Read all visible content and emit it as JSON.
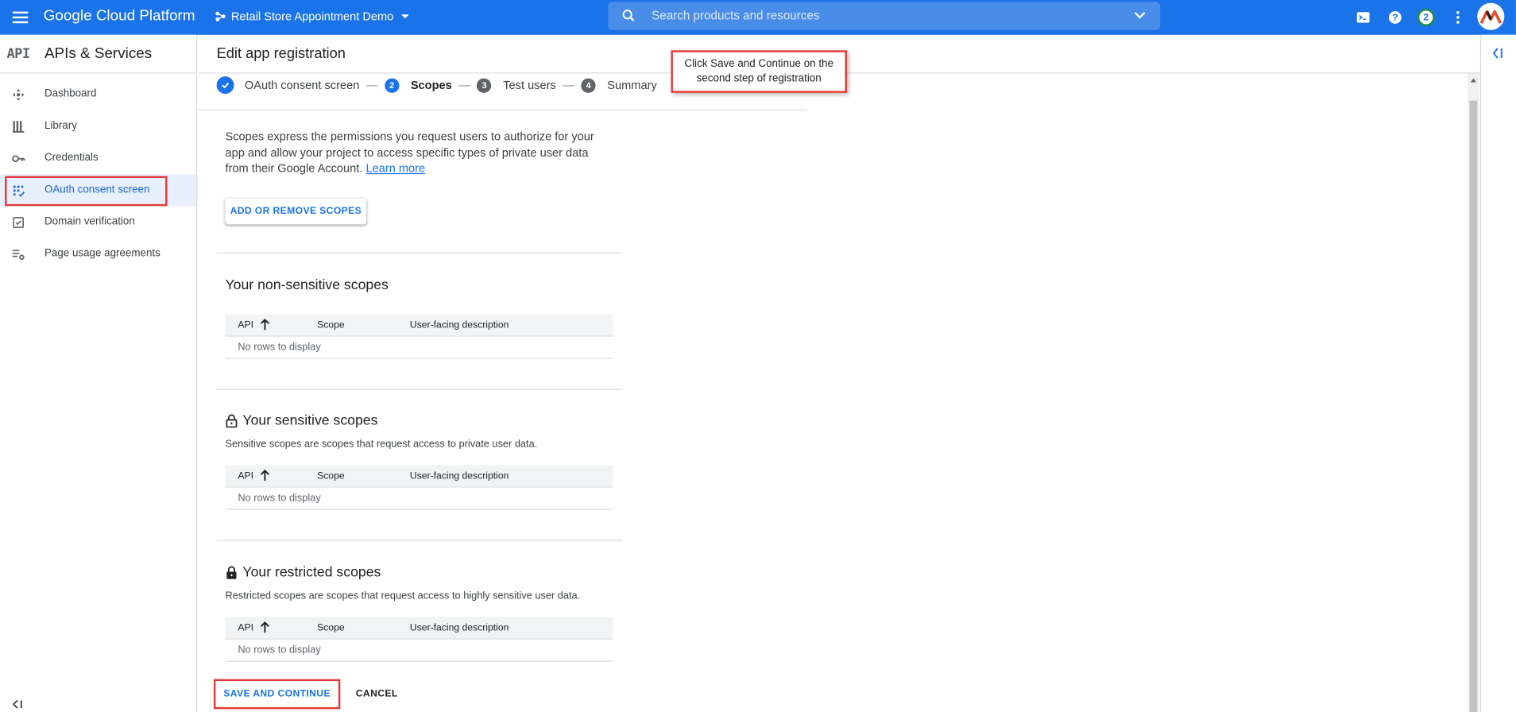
{
  "topbar": {
    "brand": "Google Cloud Platform",
    "project": "Retail Store Appointment Demo",
    "search_placeholder": "Search products and resources",
    "notification_count": "2",
    "accent_color": "#1a73e8"
  },
  "sidebar": {
    "logo": "API",
    "title": "APIs & Services",
    "items": [
      {
        "label": "Dashboard",
        "icon": "dashboard-icon"
      },
      {
        "label": "Library",
        "icon": "library-icon"
      },
      {
        "label": "Credentials",
        "icon": "key-icon"
      },
      {
        "label": "OAuth consent screen",
        "icon": "consent-icon",
        "active": true
      },
      {
        "label": "Domain verification",
        "icon": "checkbox-icon"
      },
      {
        "label": "Page usage agreements",
        "icon": "settings-list-icon"
      }
    ]
  },
  "page": {
    "title": "Edit app registration"
  },
  "stepper": {
    "steps": [
      {
        "num": "",
        "label": "OAuth consent screen",
        "state": "done"
      },
      {
        "num": "2",
        "label": "Scopes",
        "state": "current"
      },
      {
        "num": "3",
        "label": "Test users",
        "state": "pending"
      },
      {
        "num": "4",
        "label": "Summary",
        "state": "pending"
      }
    ]
  },
  "callout": {
    "line1": "Click Save and Continue on the",
    "line2": "second step of registration"
  },
  "intro": {
    "text": "Scopes express the permissions you request users to authorize for your app and allow your project to access specific types of private user data from their Google Account.",
    "link": "Learn more"
  },
  "add_button": "ADD OR REMOVE SCOPES",
  "sections": [
    {
      "title": "Your non-sensitive scopes",
      "description": "",
      "columns": [
        "API",
        "Scope",
        "User-facing description"
      ],
      "empty": "No rows to display"
    },
    {
      "title": "Your sensitive scopes",
      "description": "Sensitive scopes are scopes that request access to private user data.",
      "columns": [
        "API",
        "Scope",
        "User-facing description"
      ],
      "empty": "No rows to display"
    },
    {
      "title": "Your restricted scopes",
      "description": "Restricted scopes are scopes that request access to highly sensitive user data.",
      "columns": [
        "API",
        "Scope",
        "User-facing description"
      ],
      "empty": "No rows to display"
    }
  ],
  "actions": {
    "save": "SAVE AND CONTINUE",
    "cancel": "CANCEL"
  }
}
